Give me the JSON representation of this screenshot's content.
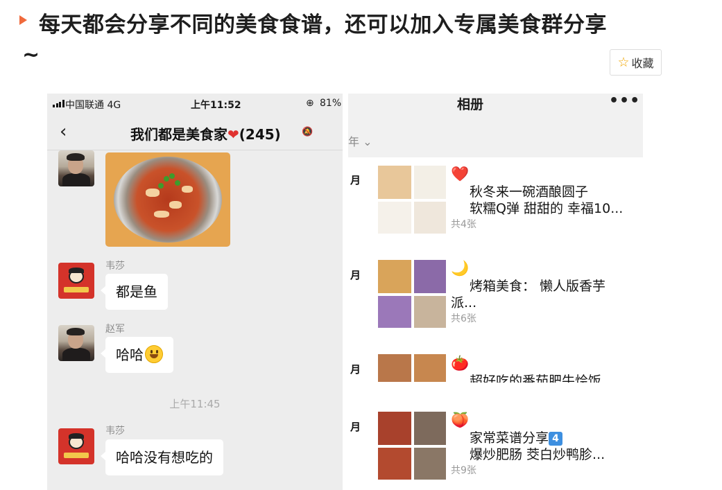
{
  "article": {
    "title": "每天都会分享不同的美食食谱，还可以加入专属美食群分享",
    "title_tail": "~",
    "favorite_label": "收藏",
    "favorite_icon": "star-outline-icon",
    "accent_color": "#f06a3c"
  },
  "chat": {
    "status": {
      "carrier": "中国联通  4G",
      "time": "上午11:52",
      "battery": "81%"
    },
    "group_name": "我们都是美食家",
    "member_count": "(245)",
    "messages": [
      {
        "sender": "韦莎",
        "text": "都是鱼"
      },
      {
        "sender": "赵军",
        "text": "哈哈"
      },
      {
        "time_separator": "上午11:45"
      },
      {
        "sender": "韦莎",
        "text": "哈哈没有想吃的"
      }
    ]
  },
  "album": {
    "title": "相册",
    "more": "•••",
    "year_filter": "年 ⌄",
    "entries": [
      {
        "month": "月",
        "icon": "❤️",
        "line1": "秋冬来一碗酒酿圆子",
        "line2": "软糯Q弹 甜甜的 幸福10...",
        "count": "共4张"
      },
      {
        "month": "月",
        "icon": "🌙",
        "line1": "烤箱美食：  懒人版香芋",
        "line2": "派...",
        "count": "共6张"
      },
      {
        "month": "月",
        "icon": "🍅",
        "line1": "超好吃的番茄肥牛烩饭",
        "line2": "",
        "count": ""
      },
      {
        "month": "月",
        "icon": "🍑",
        "line1": "家常菜谱分享",
        "badge": "4",
        "line2": "爆炒肥肠  茭白炒鸭胗...",
        "count": "共9张"
      }
    ]
  }
}
